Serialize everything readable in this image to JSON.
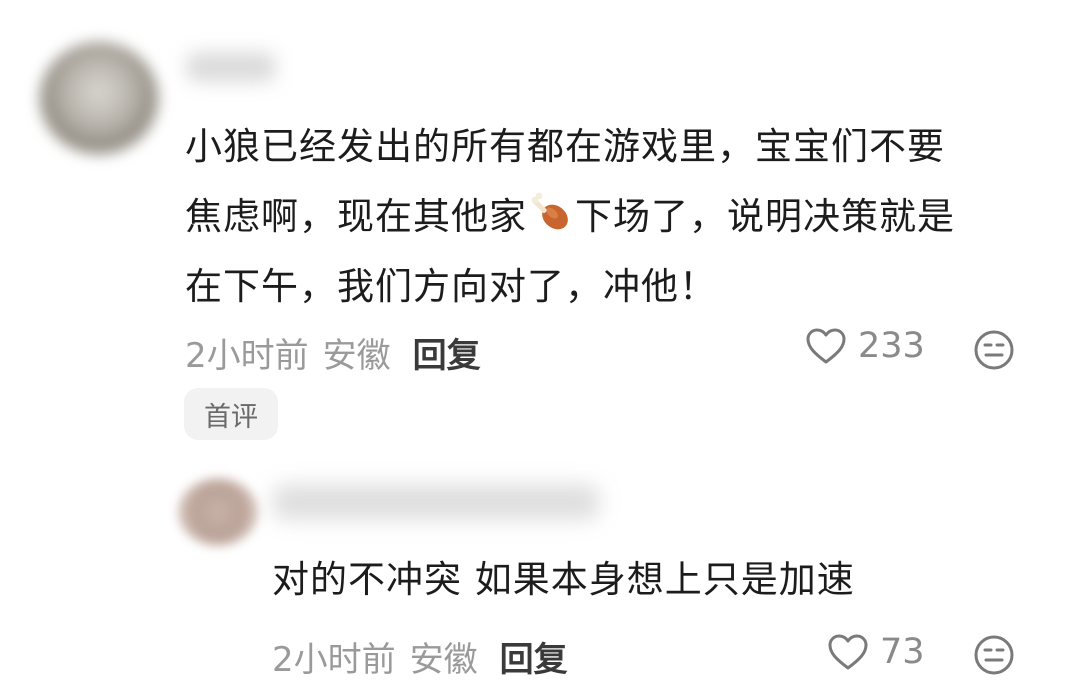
{
  "main_comment": {
    "text_line1": "小狼已经发出的所有都在游戏里，宝宝们不要",
    "text_line2_a": "焦虑啊，现在其他家",
    "text_line2_b": "下场了，说明决策就是",
    "text_line3": "在下午，我们方向对了，冲他！",
    "emoji": "drumstick-emoji",
    "time": "2小时前",
    "location": "安徽",
    "reply_label": "回复",
    "likes": "233",
    "badge": "首评"
  },
  "reply_comment": {
    "text": "对的不冲突 如果本身想上只是加速",
    "time": "2小时前",
    "location": "安徽",
    "reply_label": "回复",
    "likes": "73"
  },
  "colors": {
    "text": "#1c1c1c",
    "meta": "#9a9a9a",
    "badge_bg": "#f2f2f2"
  }
}
